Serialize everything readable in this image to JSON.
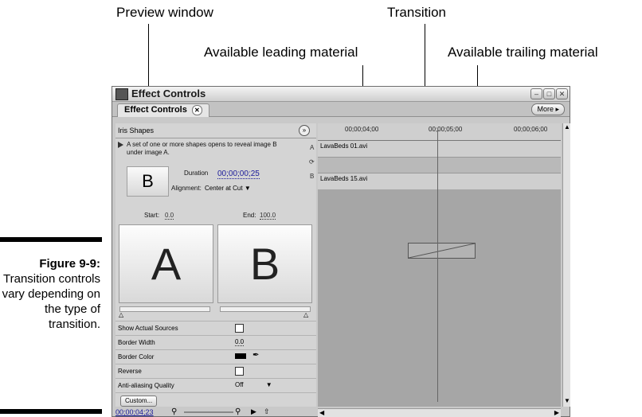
{
  "callouts": {
    "preview_window": "Preview window",
    "transition": "Transition",
    "leading": "Available leading material",
    "trailing": "Available trailing material"
  },
  "figure": {
    "label": "Figure 9-9:",
    "caption": "Transition controls vary depending on the type of transition."
  },
  "window": {
    "title": "Effect Controls",
    "tab_label": "Effect Controls",
    "more_label": "More ▸"
  },
  "effect": {
    "name": "Iris Shapes",
    "description": "A set of one or more shapes opens to reveal image B under image A.",
    "thumb_letter": "B",
    "duration_label": "Duration",
    "duration_value": "00;00;00;25",
    "alignment_label": "Alignment:",
    "alignment_value": "Center at Cut",
    "side_a": "A",
    "side_b": "B",
    "start_label": "Start:",
    "start_value": "0.0",
    "end_label": "End:",
    "end_value": "100.0",
    "preview_a": "A",
    "preview_b": "B"
  },
  "properties": {
    "show_sources": "Show Actual Sources",
    "border_width": "Border Width",
    "border_width_value": "0.0",
    "border_color": "Border Color",
    "reverse": "Reverse",
    "anti_aliasing": "Anti-aliasing Quality",
    "anti_aliasing_value": "Off",
    "custom_button": "Custom..."
  },
  "timeline": {
    "tick1": "00;00;04;00",
    "tick2": "00;00;05;00",
    "tick3": "00;00;06;00",
    "clip_a": "LavaBeds 01.avi",
    "clip_b": "LavaBeds 15.avi"
  },
  "bottom": {
    "timecode": "00;00;04;23"
  },
  "colors": {
    "window_bg": "#c9c9c9",
    "timeline_bg": "#a6a6a6"
  }
}
